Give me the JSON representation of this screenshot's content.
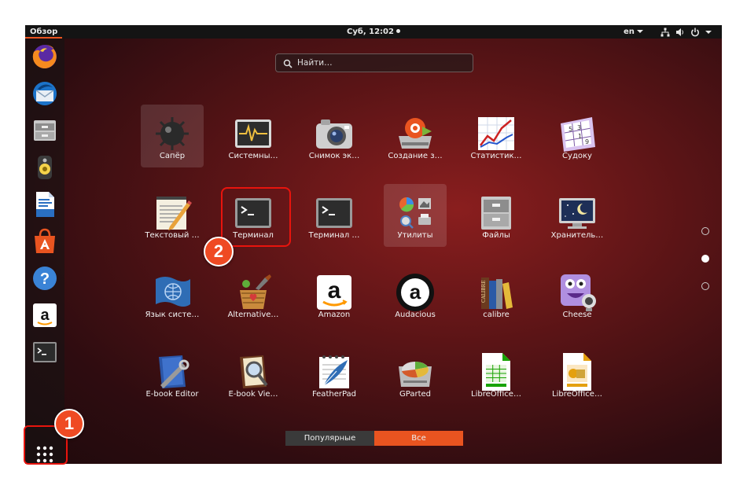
{
  "topbar": {
    "activities": "Обзор",
    "clock": "Суб, 12:02",
    "language": "en"
  },
  "dock": {
    "items": [
      {
        "name": "firefox",
        "icon": "firefox-icon"
      },
      {
        "name": "thunderbird",
        "icon": "thunderbird-icon"
      },
      {
        "name": "files",
        "icon": "file-cabinet-icon"
      },
      {
        "name": "rhythmbox",
        "icon": "speaker-icon"
      },
      {
        "name": "libreoffice-writer",
        "icon": "writer-document-icon"
      },
      {
        "name": "ubuntu-software",
        "icon": "software-bag-icon"
      },
      {
        "name": "help",
        "icon": "help-icon"
      },
      {
        "name": "amazon",
        "icon": "amazon-icon"
      },
      {
        "name": "terminal",
        "icon": "terminal-icon"
      }
    ],
    "show_apps_icon": "apps-grid-icon"
  },
  "search": {
    "placeholder": "Найти…"
  },
  "apps": [
    {
      "label": "Сапёр",
      "icon": "mine-icon"
    },
    {
      "label": "Системны…",
      "icon": "system-monitor-icon"
    },
    {
      "label": "Снимок эк…",
      "icon": "camera-icon"
    },
    {
      "label": "Создание з…",
      "icon": "startup-disk-icon"
    },
    {
      "label": "Статистик…",
      "icon": "statistics-chart-icon"
    },
    {
      "label": "Судоку",
      "icon": "sudoku-icon"
    },
    {
      "label": "Текстовый …",
      "icon": "text-editor-icon"
    },
    {
      "label": "Терминал",
      "icon": "terminal-icon"
    },
    {
      "label": "Терминал …",
      "icon": "terminal-icon"
    },
    {
      "label": "Утилиты",
      "icon": "utilities-folder-icon"
    },
    {
      "label": "Файлы",
      "icon": "file-cabinet-icon"
    },
    {
      "label": "Хранитель…",
      "icon": "screensaver-icon"
    },
    {
      "label": "Язык систе…",
      "icon": "language-flag-icon"
    },
    {
      "label": "Alternative…",
      "icon": "alternative-basket-icon"
    },
    {
      "label": "Amazon",
      "icon": "amazon-icon"
    },
    {
      "label": "Audacious",
      "icon": "audacious-icon"
    },
    {
      "label": "calibre",
      "icon": "calibre-books-icon"
    },
    {
      "label": "Cheese",
      "icon": "cheese-webcam-icon"
    },
    {
      "label": "E-book Editor",
      "icon": "ebook-editor-icon"
    },
    {
      "label": "E-book Vie…",
      "icon": "ebook-viewer-icon"
    },
    {
      "label": "FeatherPad",
      "icon": "featherpad-icon"
    },
    {
      "label": "GParted",
      "icon": "gparted-disk-icon"
    },
    {
      "label": "LibreOffice…",
      "icon": "libreoffice-calc-icon"
    },
    {
      "label": "LibreOffice…",
      "icon": "libreoffice-impress-icon"
    }
  ],
  "pager": {
    "pages": 3,
    "current": 2
  },
  "switcher": {
    "frequent": "Популярные",
    "all": "Все"
  },
  "annotations": {
    "badge_1": "1",
    "badge_2": "2"
  },
  "colors": {
    "accent": "#e95420",
    "highlight": "#e8140d"
  }
}
